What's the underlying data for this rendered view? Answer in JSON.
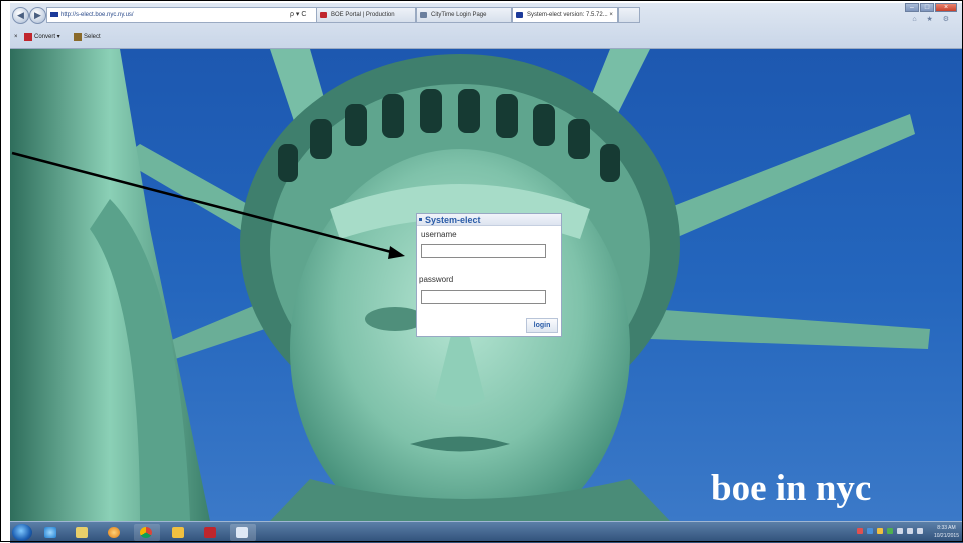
{
  "browser": {
    "address": "http://s-elect.boe.nyc.ny.us/",
    "addr_tools": "ρ ▾ C",
    "tabs": [
      {
        "label": "BOE Portal | Production"
      },
      {
        "label": "CityTime Login Page"
      },
      {
        "label": "System-elect version: 7.5.72...  ×"
      }
    ],
    "cmd": {
      "close": "×",
      "convert": "Convert  ▾",
      "select": "Select"
    },
    "window_controls": {
      "min": "–",
      "max": "□",
      "close": "×"
    },
    "right_icons": "⌂ ★ ⚙"
  },
  "login": {
    "title": "System-elect",
    "username_label": "username",
    "username_value": "",
    "password_label": "password",
    "password_value": "",
    "login_button": "login"
  },
  "watermark": "boe in nyc",
  "taskbar": {
    "items": [
      "start-orb",
      "ie-icon",
      "file-explorer-icon",
      "media-player-icon",
      "chrome-icon",
      "outlook-icon",
      "acrobat-icon",
      "app-icon"
    ],
    "clock": {
      "time": "8:33 AM",
      "date": "10/21/2015"
    }
  },
  "colors": {
    "sky": "#2466bd",
    "statue": "#7fc2aa",
    "accent": "#2b5ca8"
  }
}
